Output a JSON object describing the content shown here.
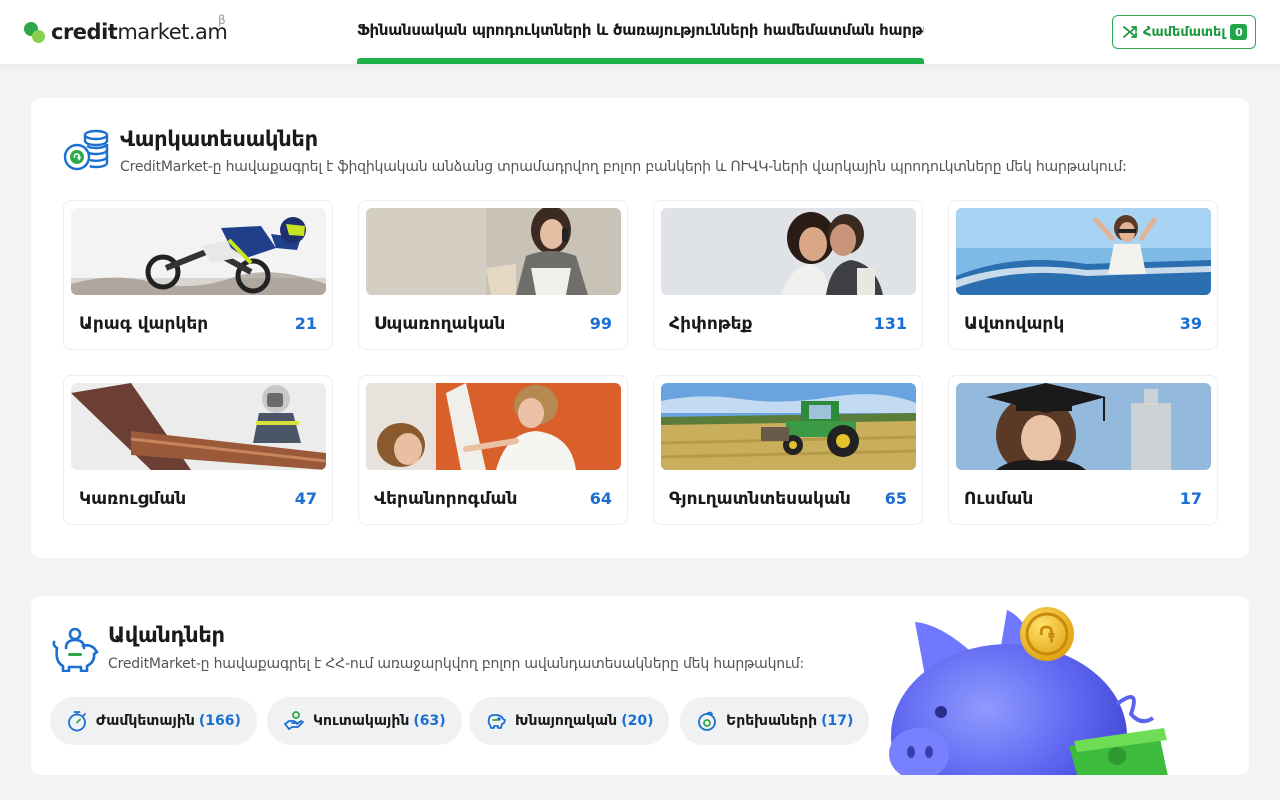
{
  "header": {
    "logo_bold": "credit",
    "logo_thin": "market.am",
    "logo_beta": "β",
    "title": "Ֆինանսական պրոդուկտների և ծառայությունների համեմատման հարթակ",
    "compare_label": "Համեմատել",
    "compare_count": "0",
    "accent": "#1fb24a"
  },
  "loans": {
    "title": "Վարկատեսակներ",
    "description": "CreditMarket-ը հավաքագրել է ֆիզիկական անձանց տրամադրվող բոլոր բանկերի և ՈՒՎԿ-ների վարկային պրոդուկտները մեկ հարթակում:",
    "icon": "coins-stack-icon",
    "items": [
      {
        "label": "Արագ վարկեր",
        "count": "21",
        "image": "motocross-rider"
      },
      {
        "label": "Սպառողական",
        "count": "99",
        "image": "woman-shopping-phone"
      },
      {
        "label": "Հիփոթեք",
        "count": "131",
        "image": "couple-kissing"
      },
      {
        "label": "Ավտովարկ",
        "count": "39",
        "image": "woman-in-convertible"
      },
      {
        "label": "Կառուցման",
        "count": "47",
        "image": "welder-worker"
      },
      {
        "label": "Վերանորոգման",
        "count": "64",
        "image": "mother-child-painting"
      },
      {
        "label": "Գյուղատնտեսական",
        "count": "65",
        "image": "tractor-field"
      },
      {
        "label": "Ուսման",
        "count": "17",
        "image": "graduate-woman"
      }
    ]
  },
  "deposits": {
    "title": "Ավանդներ",
    "description": "CreditMarket-ը հավաքագրել է ՀՀ-ում առաջարկվող բոլոր ավանդատեսակները մեկ հարթակում:",
    "icon": "piggy-bank-person-icon",
    "illustration": "blue-piggy-bank-with-coin",
    "items": [
      {
        "label": "Ժամկետային",
        "count": "(166)",
        "icon": "stopwatch-icon"
      },
      {
        "label": "Կուտակային",
        "count": "(63)",
        "icon": "hand-coins-icon"
      },
      {
        "label": "Խնայողական",
        "count": "(20)",
        "icon": "piggy-bank-icon"
      },
      {
        "label": "Երեխաների",
        "count": "(17)",
        "icon": "baby-coin-icon"
      }
    ]
  }
}
